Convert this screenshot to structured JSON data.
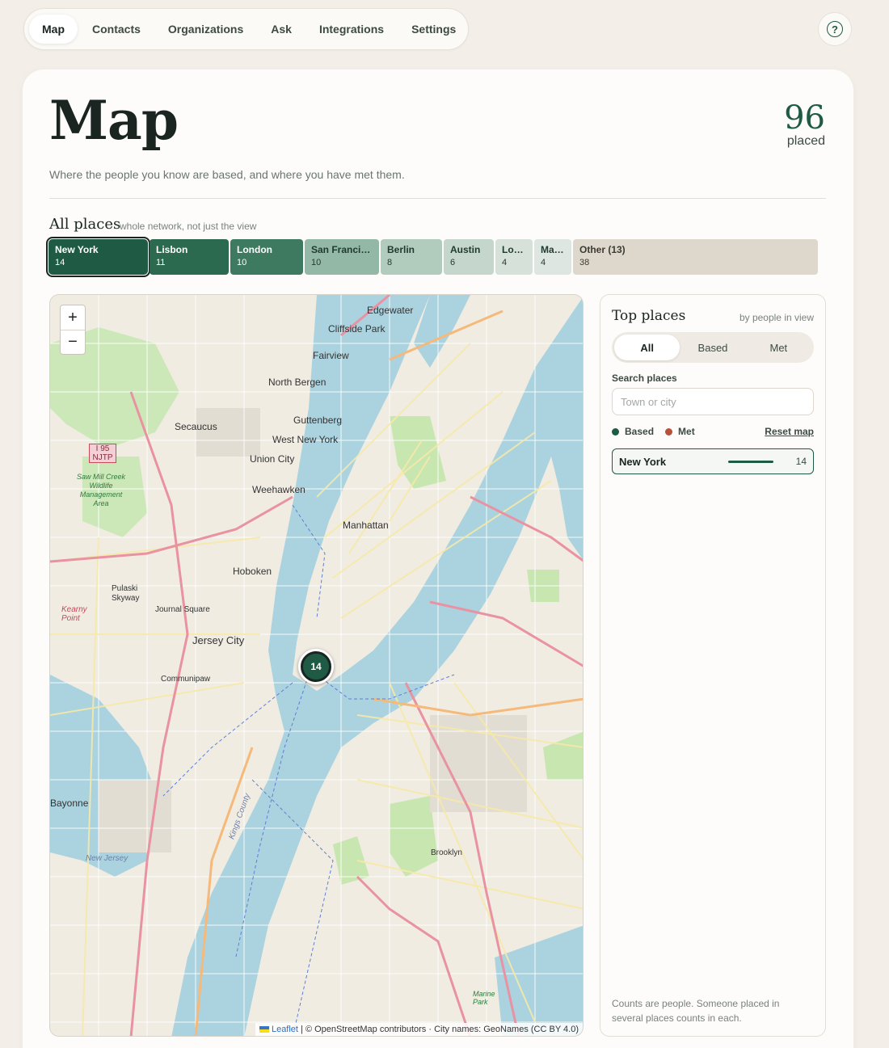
{
  "nav": {
    "items": [
      {
        "label": "Map",
        "active": true
      },
      {
        "label": "Contacts"
      },
      {
        "label": "Organizations"
      },
      {
        "label": "Ask"
      },
      {
        "label": "Integrations"
      },
      {
        "label": "Settings"
      }
    ],
    "help_icon": "question-circle-icon",
    "help_glyph": "?"
  },
  "header": {
    "title": "Map",
    "count": "96",
    "count_label": "placed",
    "subtitle": "Where the people you know are based, and where you have met them."
  },
  "all_places": {
    "title": "All places",
    "note": "whole network, not just the view",
    "chips": [
      {
        "name": "New York",
        "count": "14",
        "bg": "#1f5a44",
        "fg": "#ffffff",
        "selected": true
      },
      {
        "name": "Lisbon",
        "count": "11",
        "bg": "#2c6a50",
        "fg": "#ffffff"
      },
      {
        "name": "London",
        "count": "10",
        "bg": "#3d7a5f",
        "fg": "#ffffff"
      },
      {
        "name": "San Francisco",
        "count": "10",
        "bg": "#93b8a5",
        "fg": "#1f3a2e"
      },
      {
        "name": "Berlin",
        "count": "8",
        "bg": "#b1cbbd",
        "fg": "#1f3a2e"
      },
      {
        "name": "Austin",
        "count": "6",
        "bg": "#c5d6cd",
        "fg": "#1f3a2e"
      },
      {
        "name": "Los Angeles",
        "count": "4",
        "bg": "#d6e1da",
        "fg": "#1f3a2e"
      },
      {
        "name": "Madrid",
        "count": "4",
        "bg": "#dde6e1",
        "fg": "#1f3a2e"
      },
      {
        "name": "Other (13)",
        "count": "38",
        "bg": "#ded8cc",
        "fg": "#3b3a33"
      }
    ],
    "colors": {
      "based": "#1f5a44",
      "met": "#b5523b"
    }
  },
  "map": {
    "zoom_in": "+",
    "zoom_out": "−",
    "cluster_count": "14",
    "attribution_link": "Leaflet",
    "attribution_text": "| © OpenStreetMap contributors · City names: GeoNames (CC BY 4.0)",
    "labels": [
      "Edgewater",
      "Cliffside Park",
      "Fairview",
      "North Bergen",
      "Secaucus",
      "Guttenberg",
      "West New York",
      "Union City",
      "Weehawken",
      "Manhattan",
      "Hoboken",
      "Pulaski Skyway",
      "Journal Square",
      "Jersey City",
      "Communipaw",
      "Brooklyn",
      "Bayonne",
      "New Jersey",
      "Kings County",
      "Marine Park",
      "Kearny Point",
      "Saw Mill Creek Wildlife Management Area",
      "I 95 NJTP"
    ]
  },
  "panel": {
    "title": "Top places",
    "note": "by people in view",
    "segments": [
      {
        "label": "All",
        "active": true
      },
      {
        "label": "Based"
      },
      {
        "label": "Met"
      }
    ],
    "search_label": "Search places",
    "search_placeholder": "Town or city",
    "search_value": "",
    "legend_based": "Based",
    "legend_met": "Met",
    "reset_label": "Reset map",
    "places": [
      {
        "name": "New York",
        "count": "14"
      }
    ],
    "footnote": "Counts are people. Someone placed in several places counts in each."
  }
}
